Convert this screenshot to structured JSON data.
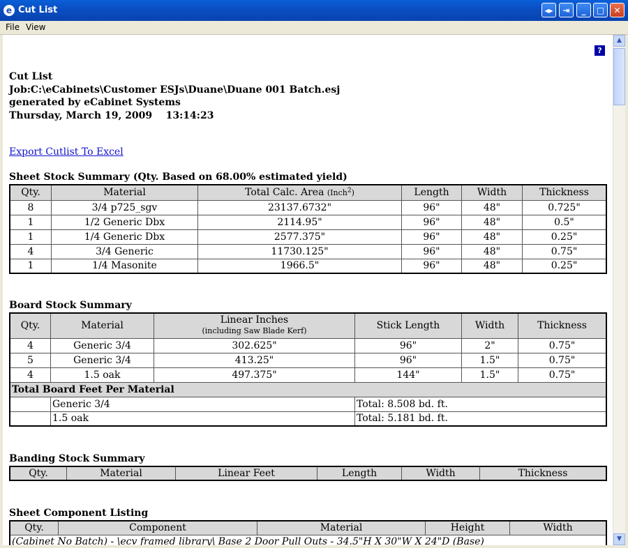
{
  "window": {
    "title": "Cut List",
    "app_icon": "e"
  },
  "menu": [
    "File",
    "View"
  ],
  "header": {
    "line1": "Cut List",
    "line2": "Job:C:\\eCabinets\\Customer ESJs\\Duane\\Duane 001 Batch.esj",
    "line3": "generated by eCabinet Systems",
    "line4": "Thursday, March 19, 2009    13:14:23"
  },
  "export_link": "Export Cutlist To Excel",
  "sheet_stock": {
    "title": "Sheet Stock Summary (Qty. Based on 68.00% estimated yield)",
    "headers": {
      "qty": "Qty.",
      "material": "Material",
      "area": "Total Calc. Area",
      "area_unit": "(Inch",
      "area_exp": "2",
      "area_close": ")",
      "length": "Length",
      "width": "Width",
      "thickness": "Thickness"
    },
    "rows": [
      [
        "8",
        "3/4 p725_sgv",
        "23137.6732\"",
        "96\"",
        "48\"",
        "0.725\""
      ],
      [
        "1",
        "1/2 Generic Dbx",
        "2114.95\"",
        "96\"",
        "48\"",
        "0.5\""
      ],
      [
        "1",
        "1/4 Generic Dbx",
        "2577.375\"",
        "96\"",
        "48\"",
        "0.25\""
      ],
      [
        "4",
        "3/4 Generic",
        "11730.125\"",
        "96\"",
        "48\"",
        "0.75\""
      ],
      [
        "1",
        "1/4 Masonite",
        "1966.5\"",
        "96\"",
        "48\"",
        "0.25\""
      ]
    ]
  },
  "board_stock": {
    "title": "Board Stock Summary",
    "headers": {
      "qty": "Qty.",
      "material": "Material",
      "linear": "Linear Inches",
      "linear_sub": "(including Saw Blade Kerf)",
      "stick": "Stick Length",
      "width": "Width",
      "thickness": "Thickness"
    },
    "rows": [
      [
        "4",
        "Generic 3/4",
        "302.625\"",
        "96\"",
        "2\"",
        "0.75\""
      ],
      [
        "5",
        "Generic 3/4",
        "413.25\"",
        "96\"",
        "1.5\"",
        "0.75\""
      ],
      [
        "4",
        "1.5 oak",
        "497.375\"",
        "144\"",
        "1.5\"",
        "0.75\""
      ]
    ],
    "total_title": "Total Board Feet Per Material",
    "totals": [
      [
        "Generic 3/4",
        "Total: 8.508 bd. ft."
      ],
      [
        "1.5 oak",
        "Total: 5.181 bd. ft."
      ]
    ]
  },
  "banding_stock": {
    "title": "Banding Stock Summary",
    "headers": [
      "Qty.",
      "Material",
      "Linear Feet",
      "Length",
      "Width",
      "Thickness"
    ]
  },
  "sheet_component": {
    "title": "Sheet Component Listing",
    "headers": [
      "Qty.",
      "Component",
      "Material",
      "Height",
      "Width"
    ],
    "partial_row": "(Cabinet No Batch) - \\ecv framed library\\ Base 2 Door Pull Outs - 34.5\"H X 30\"W X 24\"D (Base)"
  }
}
